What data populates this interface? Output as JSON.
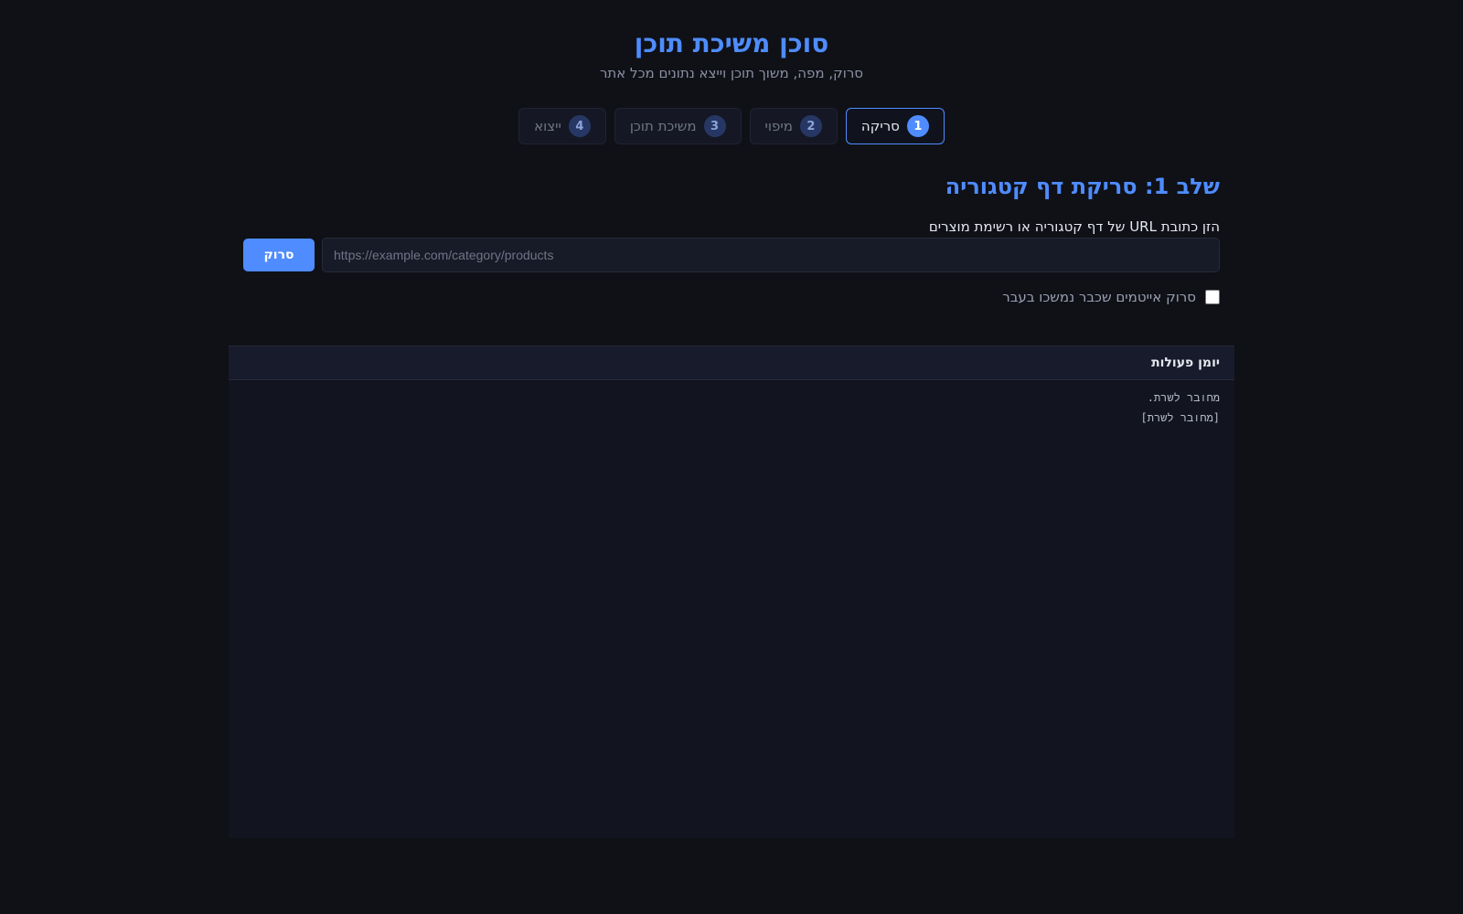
{
  "header": {
    "title": "סוכן משיכת תוכן",
    "subtitle": "סרוק, מפה, משוך תוכן וייצא נתונים מכל אתר"
  },
  "steps": [
    {
      "num": "1",
      "label": "סריקה",
      "active": true
    },
    {
      "num": "2",
      "label": "מיפוי",
      "active": false
    },
    {
      "num": "3",
      "label": "משיכת תוכן",
      "active": false
    },
    {
      "num": "4",
      "label": "ייצוא",
      "active": false
    }
  ],
  "scan": {
    "title": "שלב 1: סריקת דף קטגוריה",
    "url_label": "הזן כתובת URL של דף קטגוריה או רשימת מוצרים",
    "url_placeholder": "https://example.com/category/products",
    "url_value": "",
    "button_label": "סרוק",
    "rescan_label": "סרוק אייטמים שכבר נמשכו בעבר",
    "rescan_checked": false
  },
  "log": {
    "title": "יומן פעולות",
    "lines": [
      "מחובר לשרת.",
      "[מחובר לשרת]"
    ]
  },
  "colors": {
    "background": "#0f1117",
    "accent": "#4f8cff",
    "panel": "#121420"
  }
}
